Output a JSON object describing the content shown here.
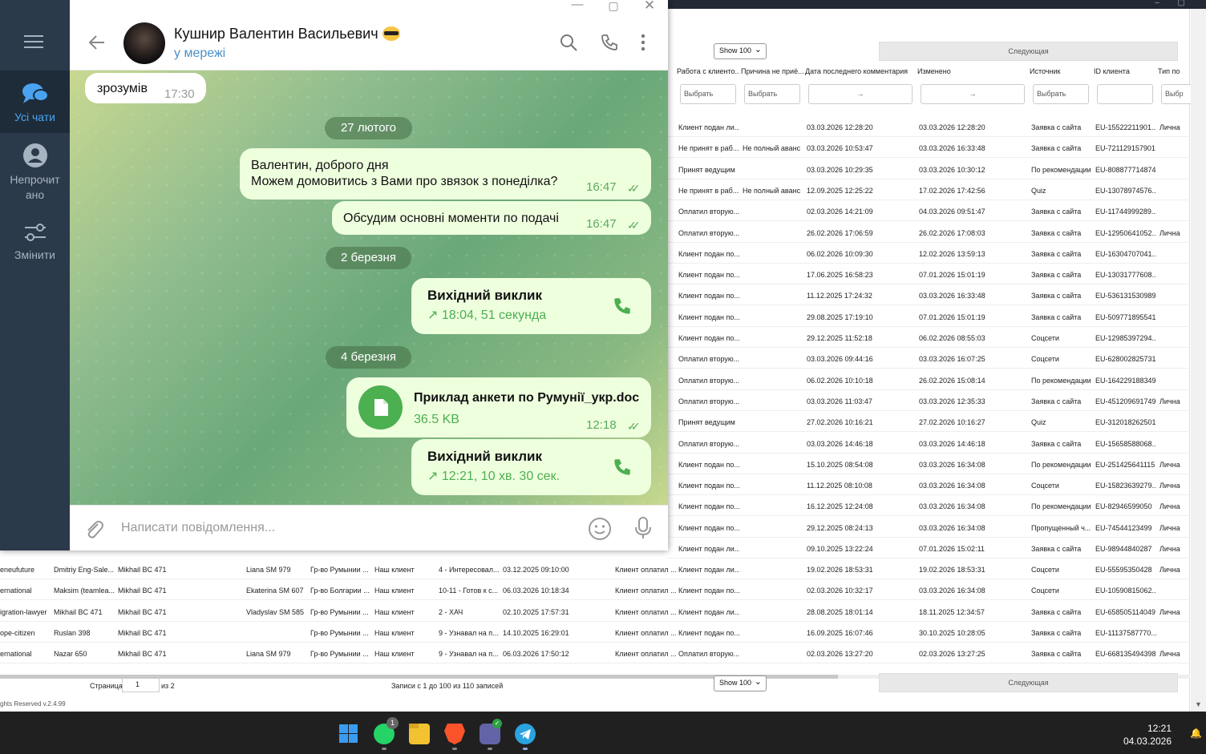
{
  "crm": {
    "show_label": "Show 100",
    "next_label": "Следующая",
    "columns": [
      "Работа с клиенто...",
      "Причина не приё...",
      "Дата последнего комментария",
      "Изменено",
      "Источник",
      "ID клиента",
      "Тип по"
    ],
    "filters": {
      "select": "Выбрать",
      "arrow": "→",
      "partial": "Выбр"
    },
    "top_rows": [
      [
        "Клиент подан ли...",
        "",
        "03.03.2026 12:28:20",
        "03.03.2026 12:28:20",
        "Заявка с сайта",
        "EU-15522211901...",
        "Лична"
      ],
      [
        "Не принят в раб...",
        "Не полный аванс",
        "03.03.2026 10:53:47",
        "03.03.2026 16:33:48",
        "Заявка с сайта",
        "EU-721129157901",
        ""
      ],
      [
        "Принят ведущим",
        "",
        "03.03.2026 10:29:35",
        "03.03.2026 10:30:12",
        "По рекомендации",
        "EU-808877714874",
        ""
      ],
      [
        "Не принят в раб...",
        "Не полный аванс",
        "12.09.2025 12:25:22",
        "17.02.2026 17:42:56",
        "Quiz",
        "EU-13078974576...",
        ""
      ],
      [
        "Оплатил вторую...",
        "",
        "02.03.2026 14:21:09",
        "04.03.2026 09:51:47",
        "Заявка с сайта",
        "EU-11744999289...",
        ""
      ],
      [
        "Оплатил вторую...",
        "",
        "26.02.2026 17:06:59",
        "26.02.2026 17:08:03",
        "Заявка с сайта",
        "EU-12950641052...",
        "Лична"
      ],
      [
        "Клиент подан по...",
        "",
        "06.02.2026 10:09:30",
        "12.02.2026 13:59:13",
        "Заявка с сайта",
        "EU-16304707041...",
        ""
      ],
      [
        "Клиент подан по...",
        "",
        "17.06.2025 16:58:23",
        "07.01.2026 15:01:19",
        "Заявка с сайта",
        "EU-13031777608...",
        ""
      ],
      [
        "Клиент подан по...",
        "",
        "11.12.2025 17:24:32",
        "03.03.2026 16:33:48",
        "Заявка с сайта",
        "EU-536131530989",
        ""
      ],
      [
        "Клиент подан по...",
        "",
        "29.08.2025 17:19:10",
        "07.01.2026 15:01:19",
        "Заявка с сайта",
        "EU-509771895541",
        ""
      ],
      [
        "Клиент подан по...",
        "",
        "29.12.2025 11:52:18",
        "06.02.2026 08:55:03",
        "Соцсети",
        "EU-12985397294...",
        ""
      ],
      [
        "Оплатил вторую...",
        "",
        "03.03.2026 09:44:16",
        "03.03.2026 16:07:25",
        "Соцсети",
        "EU-628002825731",
        ""
      ],
      [
        "Оплатил вторую...",
        "",
        "06.02.2026 10:10:18",
        "26.02.2026 15:08:14",
        "По рекомендации",
        "EU-164229188349",
        ""
      ],
      [
        "Оплатил вторую...",
        "",
        "03.03.2026 11:03:47",
        "03.03.2026 12:35:33",
        "Заявка с сайта",
        "EU-451209691749",
        "Лична"
      ],
      [
        "Принят ведущим",
        "",
        "27.02.2026 10:16:21",
        "27.02.2026 10:16:27",
        "Quiz",
        "EU-312018262501",
        ""
      ],
      [
        "Оплатил вторую...",
        "",
        "03.03.2026 14:46:18",
        "03.03.2026 14:46:18",
        "Заявка с сайта",
        "EU-15658588068...",
        ""
      ],
      [
        "Клиент подан по...",
        "",
        "15.10.2025 08:54:08",
        "03.03.2026 16:34:08",
        "По рекомендации",
        "EU-251425641115",
        "Лична"
      ],
      [
        "Клиент подан по...",
        "",
        "11.12.2025 08:10:08",
        "03.03.2026 16:34:08",
        "Соцсети",
        "EU-15823639279...",
        "Лична"
      ],
      [
        "Клиент подан по...",
        "",
        "16.12.2025 12:24:08",
        "03.03.2026 16:34:08",
        "По рекомендации",
        "EU-82946599050",
        "Лична"
      ],
      [
        "Клиент подан по...",
        "",
        "29.12.2025 08:24:13",
        "03.03.2026 16:34:08",
        "Пропущенный ч...",
        "EU-74544123499",
        "Лична"
      ],
      [
        "Клиент подан ли...",
        "",
        "09.10.2025 13:22:24",
        "07.01.2026 15:02:11",
        "Заявка с сайта",
        "EU-98944840287",
        "Лична"
      ]
    ],
    "bottom_rows": [
      [
        "eneufuture",
        "Dmitriy Eng-Sale...",
        "Mikhail BC 471",
        "Liana SM 979",
        "Гр-во Румынии ...",
        "Наш клиент",
        "4 - Интересовал...",
        "03.12.2025 09:10:00",
        "Клиент оплатил ...",
        "Клиент подан ли...",
        "",
        "19.02.2026 18:53:31",
        "19.02.2026 18:53:31",
        "Соцсети",
        "EU-55595350428",
        "Лична"
      ],
      [
        "ernational",
        "Maksim (teamlea...",
        "Mikhail BC 471",
        "Ekaterina SM 607",
        "Гр-во Болгарии ...",
        "Наш клиент",
        "10-11 - Готов к с...",
        "06.03.2026 10:18:34",
        "Клиент оплатил ...",
        "Клиент подан по...",
        "",
        "02.03.2026 10:32:17",
        "03.03.2026 16:34:08",
        "Соцсети",
        "EU-10590815062...",
        ""
      ],
      [
        "igration-lawyer",
        "Mikhail BC 471",
        "Mikhail BC 471",
        "Vladyslav SM 585",
        "Гр-во Румынии ...",
        "Наш клиент",
        "2 - ХАЧ",
        "02.10.2025 17:57:31",
        "Клиент оплатил ...",
        "Клиент подан ли...",
        "",
        "28.08.2025 18:01:14",
        "18.11.2025 12:34:57",
        "Заявка с сайта",
        "EU-658505114049",
        "Лична"
      ],
      [
        "ope-citizen",
        "Ruslan 398",
        "Mikhail BC 471",
        "",
        "Гр-во Румынии ...",
        "Наш клиент",
        "9 - Узнавал на п...",
        "14.10.2025 16:29:01",
        "Клиент оплатил ...",
        "Клиент подан по...",
        "",
        "16.09.2025 16:07:46",
        "30.10.2025 10:28:05",
        "Заявка с сайта",
        "EU-11137587770...",
        ""
      ],
      [
        "ernational",
        "Nazar 650",
        "Mikhail BC 471",
        "Liana SM 979",
        "Гр-во Румынии ...",
        "Наш клиент",
        "9 - Узнавал на п...",
        "06.03.2026 17:50:12",
        "Клиент оплатил ...",
        "Оплатил вторую...",
        "",
        "02.03.2026 13:27:20",
        "02.03.2026 13:27:25",
        "Заявка с сайта",
        "EU-668135494398",
        "Лична"
      ]
    ],
    "pager": {
      "page_label": "Страница",
      "page_value": "1",
      "of_label": "из 2",
      "records": "Записи с 1 до 100 из 110 записей"
    },
    "copyright": "ghts Reserved v.2.4.99"
  },
  "telegram": {
    "sidebar": {
      "all_chats": "Усі чати",
      "unread_line1": "Непрочит",
      "unread_line2": "ано",
      "edit": "Змінити"
    },
    "chat": {
      "name": "Кушнир Валентин Васильевич",
      "status": "у мережі"
    },
    "messages": {
      "m1_text": "зрозумів",
      "m1_time": "17:30",
      "date1": "27 лютого",
      "m2_line1": "Валентин, доброго дня",
      "m2_line2": "Можем домовитись з Вами про звязок з понеділка?",
      "m2_time": "16:47",
      "m3_text": "Обсудим основні моменти по подачі",
      "m3_time": "16:47",
      "date2": "2 березня",
      "call1_title": "Вихідний виклик",
      "call1_sub": "18:04, 51 секунда",
      "date3": "4 березня",
      "file_name": "Приклад анкети по Румунії_укр.doc",
      "file_size": "36.5 KB",
      "file_time": "12:18",
      "call2_title": "Вихідний виклик",
      "call2_sub": "12:21, 10 хв. 30 сек."
    },
    "input_placeholder": "Написати повідомлення..."
  },
  "taskbar": {
    "whatsapp_badge": "1",
    "time": "12:21",
    "date": "04.03.2026"
  },
  "colors": {
    "tg_accent": "#4caf50",
    "tg_sidebar": "#2b3a4a",
    "tg_active_tab": "#4aa3f0",
    "taskbar": "#202020"
  }
}
